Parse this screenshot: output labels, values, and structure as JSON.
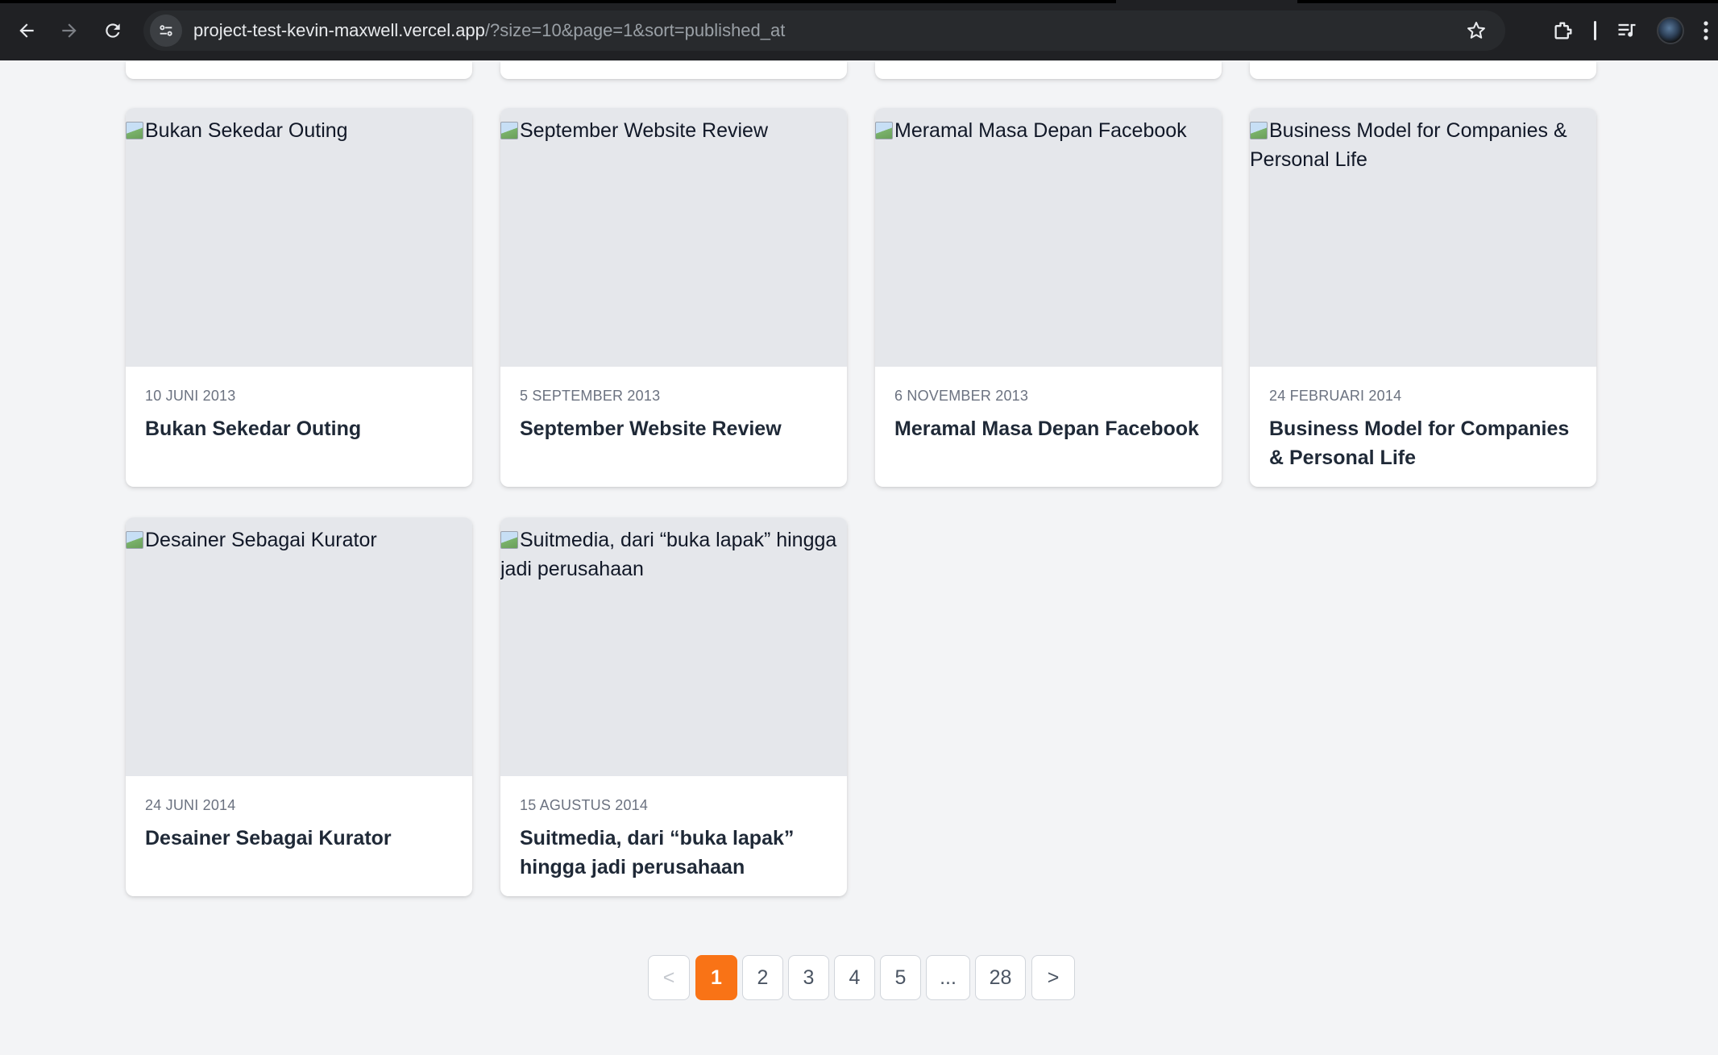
{
  "browser": {
    "url_host": "project-test-kevin-maxwell.vercel.app",
    "url_path": "/?size=10&page=1&sort=published_at",
    "icons": [
      "back-arrow-icon",
      "forward-arrow-icon",
      "reload-icon",
      "site-info-icon",
      "bookmark-star-icon",
      "extensions-icon",
      "media-controls-icon",
      "profile-avatar"
    ]
  },
  "posts": [
    {
      "image_alt": "Bukan Sekedar Outing",
      "date": "10 JUNI 2013",
      "title": "Bukan Sekedar Outing"
    },
    {
      "image_alt": "September Website Review",
      "date": "5 SEPTEMBER 2013",
      "title": "September Website Review"
    },
    {
      "image_alt": "Meramal Masa Depan Facebook",
      "date": "6 NOVEMBER 2013",
      "title": "Meramal Masa Depan Facebook"
    },
    {
      "image_alt": "Business Model for Companies & Personal Life",
      "date": "24 FEBRUARI 2014",
      "title": "Business Model for Companies & Personal Life"
    },
    {
      "image_alt": "Desainer Sebagai Kurator",
      "date": "24 JUNI 2014",
      "title": "Desainer Sebagai Kurator"
    },
    {
      "image_alt": "Suitmedia, dari “buka lapak” hingga jadi perusahaan",
      "date": "15 AGUSTUS 2014",
      "title": "Suitmedia, dari “buka lapak” hingga jadi perusahaan"
    }
  ],
  "pagination": {
    "prev": "<",
    "pages": [
      "1",
      "2",
      "3",
      "4",
      "5"
    ],
    "ellipsis": "...",
    "last": "28",
    "next": ">",
    "current": "1"
  },
  "colors": {
    "accent": "#f97316",
    "page_bg": "#f3f4f6",
    "thumb_bg": "#e5e7eb"
  }
}
